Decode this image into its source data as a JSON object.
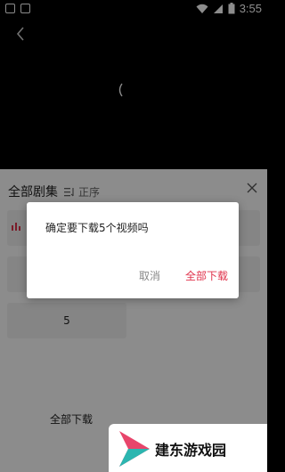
{
  "status_bar": {
    "time": "3:55"
  },
  "panel": {
    "title": "全部剧集",
    "sort_label": "正序",
    "visible_episode": "5",
    "download_all_label": "全部下载"
  },
  "dialog": {
    "message": "确定要下载5个视频吗",
    "cancel_label": "取消",
    "confirm_label": "全部下载"
  },
  "watermark": {
    "text": "建东游戏园"
  },
  "colors": {
    "accent": "#e0324b",
    "dialog_bg": "#ffffff",
    "overlay": "rgba(0,0,0,0.45)"
  }
}
